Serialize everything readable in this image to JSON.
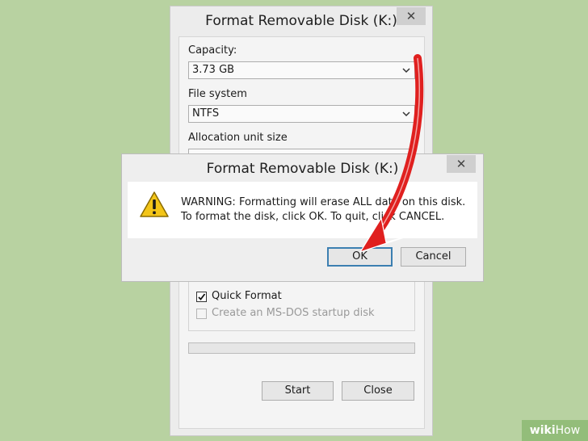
{
  "format_dialog": {
    "title": "Format Removable Disk (K:)",
    "close_glyph": "✕",
    "capacity_label": "Capacity:",
    "capacity_value": "3.73 GB",
    "filesystem_label": "File system",
    "filesystem_value": "NTFS",
    "allocation_label": "Allocation unit size",
    "quick_format_label": "Quick Format",
    "quick_format_checked": true,
    "msdos_label": "Create an MS-DOS startup disk",
    "msdos_checked": false,
    "start_label": "Start",
    "close_label": "Close",
    "progress_fraction": 0
  },
  "warning_dialog": {
    "title": "Format Removable Disk (K:)",
    "close_glyph": "✕",
    "icon": "warning-icon",
    "message_line1": "WARNING: Formatting will erase ALL data on this disk.",
    "message_line2": "To format the disk, click OK. To quit, click CANCEL.",
    "ok_label": "OK",
    "cancel_label": "Cancel"
  },
  "annotation": {
    "arrow_color": "#e0201f",
    "arrow_target": "ok-button"
  },
  "watermark": {
    "part1": "wiki",
    "part2": "How"
  }
}
